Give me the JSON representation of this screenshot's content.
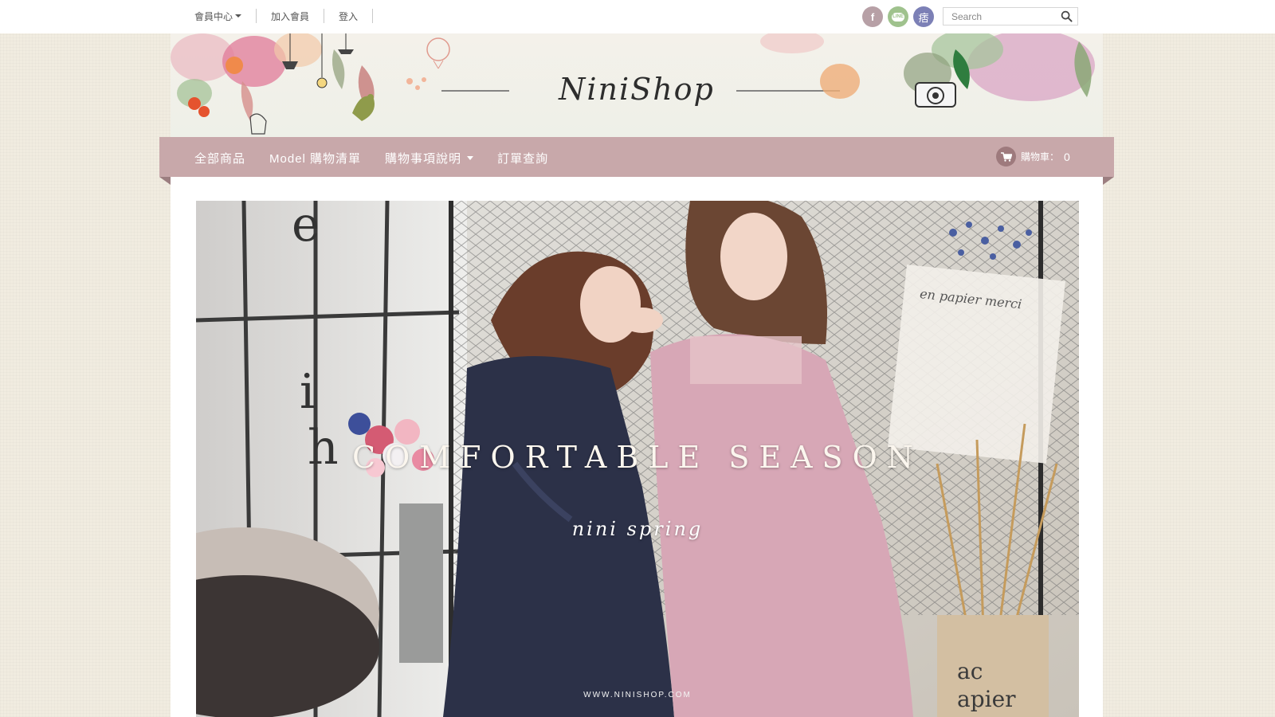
{
  "topbar": {
    "member_center": "會員中心",
    "join": "加入會員",
    "login": "登入",
    "social": {
      "facebook": "f",
      "line": "LINE",
      "pixnet": "痞"
    },
    "search": {
      "placeholder": "Search",
      "value": ""
    }
  },
  "banner": {
    "logo": "NiniShop"
  },
  "nav": {
    "items": [
      "全部商品",
      "Model 購物清單",
      "購物事項說明",
      "訂單查詢"
    ],
    "cart_label": "購物車：",
    "cart_count": "0"
  },
  "hero": {
    "title": "COMFORTABLE SEASON",
    "subtitle": "nini spring",
    "url": "WWW.NINISHOP.COM"
  },
  "colors": {
    "background": "#f1ece0",
    "nav": "#c8a8aa",
    "nav_fold": "#9c7e80",
    "cart_circle": "#9e7a7d",
    "facebook": "#b7a0a6",
    "line": "#9fc28d",
    "pixnet": "#7c80b6"
  },
  "icons": [
    "facebook-icon",
    "line-icon",
    "pixnet-icon",
    "search-icon",
    "cart-icon",
    "chevron-down-icon"
  ]
}
